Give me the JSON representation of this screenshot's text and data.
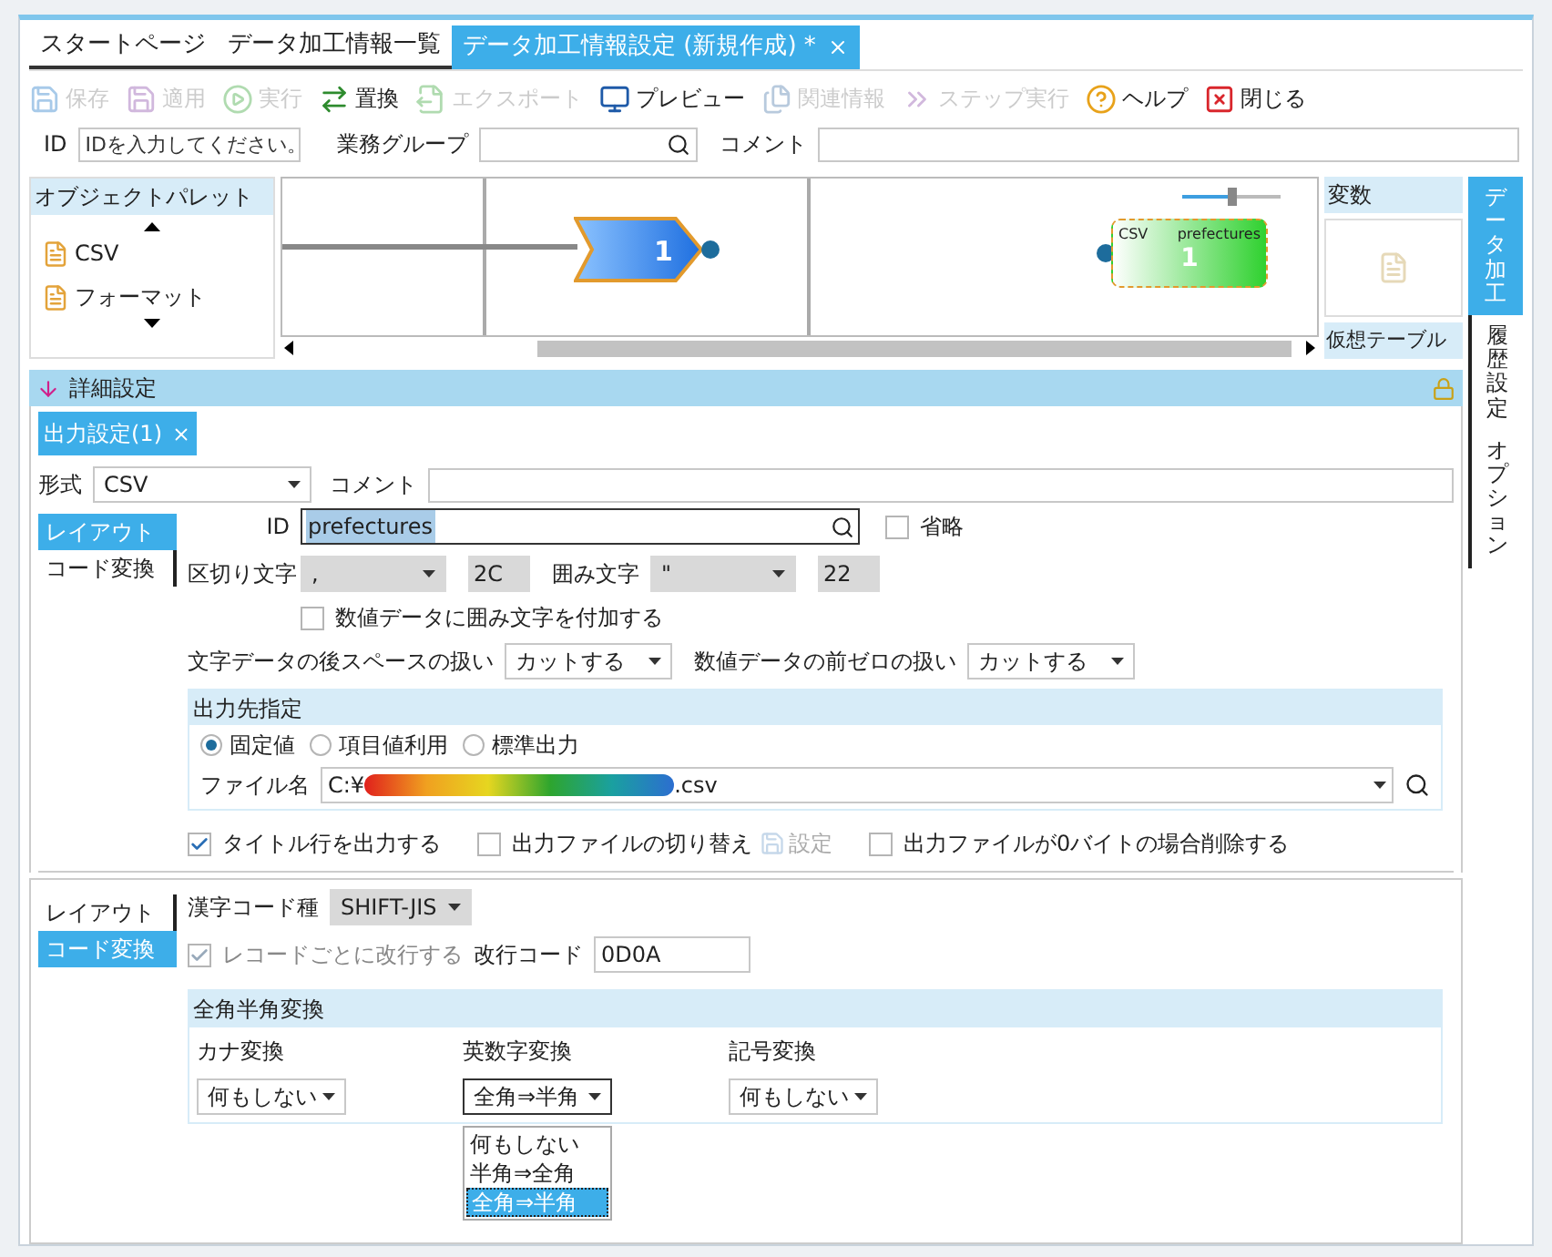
{
  "tabs": [
    {
      "label": "スタートページ",
      "selected": false
    },
    {
      "label": "データ加工情報一覧",
      "selected": false
    },
    {
      "label": "データ加工情報設定 (新規作成) *",
      "selected": true
    }
  ],
  "toolbar": [
    {
      "label": "保存",
      "disabled": true
    },
    {
      "label": "適用",
      "disabled": true
    },
    {
      "label": "実行",
      "disabled": true
    },
    {
      "label": "置換",
      "disabled": false
    },
    {
      "label": "エクスポート",
      "disabled": true
    },
    {
      "label": "プレビュー",
      "disabled": false
    },
    {
      "label": "関連情報",
      "disabled": true
    },
    {
      "label": "ステップ実行",
      "disabled": true
    },
    {
      "label": "ヘルプ",
      "disabled": false
    },
    {
      "label": "閉じる",
      "disabled": false
    }
  ],
  "header_fields": {
    "id_label": "ID",
    "id_placeholder": "IDを入力してください。",
    "group_label": "業務グループ",
    "comment_label": "コメント"
  },
  "palette": {
    "title": "オブジェクトパレット",
    "items": [
      {
        "label": "CSV"
      },
      {
        "label": "フォーマット"
      }
    ]
  },
  "canvas": {
    "zoom": {
      "level": 0.5
    },
    "filter_node": {
      "label": "1"
    },
    "csv_node": {
      "type": "CSV",
      "name": "prefectures",
      "label": "1"
    }
  },
  "variables": {
    "title": "変数",
    "virtual_table": "仮想テーブル"
  },
  "side_tabs": [
    {
      "label": "データ加工",
      "selected": true
    },
    {
      "label": "履歴設定",
      "selected": false
    },
    {
      "label": "オプション",
      "selected": false
    }
  ],
  "details": {
    "title": "詳細設定"
  },
  "output_panel": {
    "tab": "出力設定(1)",
    "format_label": "形式",
    "format_value": "CSV",
    "comment_label": "コメント",
    "subtabs": [
      {
        "label": "レイアウト",
        "selected": true
      },
      {
        "label": "コード変換",
        "selected": false
      }
    ],
    "id_label": "ID",
    "id_value": "prefectures",
    "omit": {
      "label": "省略",
      "checked": false
    },
    "delimiter_label": "区切り文字",
    "delimiter_value": ",",
    "delimiter_code": "2C",
    "quote_label": "囲み文字",
    "quote_value": "\"",
    "quote_code": "22",
    "numeric_quote": {
      "label": "数値データに囲み文字を付加する",
      "checked": false
    },
    "trailing_label": "文字データの後スペースの扱い",
    "trailing_value": "カットする",
    "zero_label": "数値データの前ゼロの扱い",
    "zero_value": "カットする",
    "destination": {
      "title": "出力先指定",
      "radios": [
        {
          "label": "固定値",
          "selected": true
        },
        {
          "label": "項目値利用",
          "selected": false
        },
        {
          "label": "標準出力",
          "selected": false
        }
      ],
      "file_label": "ファイル名",
      "file_prefix": "C:¥",
      "file_suffix": ".csv"
    },
    "options": [
      {
        "kind": "checkbox",
        "label": "タイトル行を出力する",
        "checked": true
      },
      {
        "kind": "checkbox",
        "label": "出力ファイルの切り替え",
        "checked": false
      },
      {
        "kind": "button",
        "label": "設定",
        "disabled": true
      },
      {
        "kind": "checkbox",
        "label": "出力ファイルが0バイトの場合削除する",
        "checked": false
      }
    ]
  },
  "code_panel": {
    "subtabs": [
      {
        "label": "レイアウト",
        "selected": false
      },
      {
        "label": "コード変換",
        "selected": true
      }
    ],
    "kanji_label": "漢字コード種",
    "kanji_value": "SHIFT-JIS",
    "record_newline": {
      "label": "レコードごとに改行する",
      "checked": true,
      "disabled": true
    },
    "newline_label": "改行コード",
    "newline_value": "0D0A",
    "conversion": {
      "title": "全角半角変換",
      "columns": [
        {
          "label": "カナ変換",
          "value": "何もしない",
          "open": false
        },
        {
          "label": "英数字変換",
          "value": "全角⇒半角",
          "open": true,
          "options": [
            {
              "label": "何もしない",
              "selected": false
            },
            {
              "label": "半角⇒全角",
              "selected": false
            },
            {
              "label": "全角⇒半角",
              "selected": true
            }
          ]
        },
        {
          "label": "記号変換",
          "value": "何もしない",
          "open": false
        }
      ]
    }
  }
}
